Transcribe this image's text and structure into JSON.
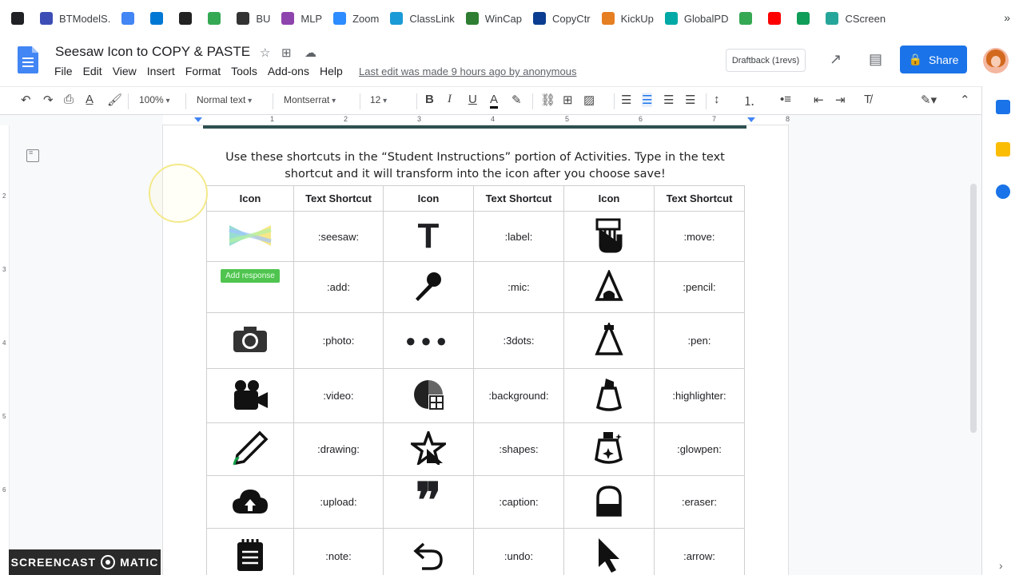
{
  "bookmarks": [
    {
      "label": "",
      "icon": "apps-icon",
      "color": "#202124"
    },
    {
      "label": "BTModelS.",
      "icon": "bookmark-icon",
      "color": "#3c4eb5"
    },
    {
      "label": "",
      "icon": "globe-icon",
      "color": "#4285f4"
    },
    {
      "label": "",
      "icon": "outlook-icon",
      "color": "#0078d4"
    },
    {
      "label": "",
      "icon": "s-circle-icon",
      "color": "#222"
    },
    {
      "label": "",
      "icon": "link-icon",
      "color": "#34a853"
    },
    {
      "label": "BU",
      "icon": "bu-icon",
      "color": "#333"
    },
    {
      "label": "MLP",
      "icon": "mlp-icon",
      "color": "#8e44ad"
    },
    {
      "label": "Zoom",
      "icon": "zoom-icon",
      "color": "#2d8cff"
    },
    {
      "label": "ClassLink",
      "icon": "classlink-icon",
      "color": "#1a9bd7"
    },
    {
      "label": "WinCap",
      "icon": "wincap-icon",
      "color": "#2e7d32"
    },
    {
      "label": "CopyCtr",
      "icon": "b-icon",
      "color": "#0a3d91"
    },
    {
      "label": "KickUp",
      "icon": "kickup-icon",
      "color": "#e67e22"
    },
    {
      "label": "GlobalPD",
      "icon": "globalpd-icon",
      "color": "#00a9a5"
    },
    {
      "label": "",
      "icon": "link-icon",
      "color": "#34a853"
    },
    {
      "label": "",
      "icon": "youtube-icon",
      "color": "#ff0000"
    },
    {
      "label": "",
      "icon": "sheet-icon",
      "color": "#0f9d58"
    },
    {
      "label": "CScreen",
      "icon": "cscreen-icon",
      "color": "#26a69a"
    }
  ],
  "bookmarks_more": "»",
  "doc": {
    "title": "Seesaw Icon to COPY & PASTE",
    "menu": [
      "File",
      "Edit",
      "View",
      "Insert",
      "Format",
      "Tools",
      "Add-ons",
      "Help"
    ],
    "last_edit": "Last edit was made 9 hours ago by anonymous",
    "draftback": "Draftback (1revs)",
    "share": "Share"
  },
  "toolbar": {
    "zoom": "100%",
    "style": "Normal text",
    "font": "Montserrat",
    "size": "12"
  },
  "ruler_numbers": [
    "1",
    "2",
    "3",
    "4",
    "5",
    "6",
    "7",
    "8"
  ],
  "vruler_numbers": [
    "2",
    "3",
    "4",
    "5",
    "6"
  ],
  "instructions": "Use these shortcuts in the “Student Instructions” portion of Activities.  Type in the text shortcut and it will transform into the icon after you choose save!",
  "table": {
    "headers": [
      "Icon",
      "Text Shortcut",
      "Icon",
      "Text Shortcut",
      "Icon",
      "Text Shortcut"
    ],
    "rows": [
      [
        ":seesaw:",
        ":label:",
        ":move:"
      ],
      [
        ":add:",
        ":mic:",
        ":pencil:"
      ],
      [
        ":photo:",
        ":3dots:",
        ":pen:"
      ],
      [
        ":video:",
        ":background:",
        ":highlighter:"
      ],
      [
        ":drawing:",
        ":shapes:",
        ":glowpen:"
      ],
      [
        ":upload:",
        ":caption:",
        ":eraser:"
      ],
      [
        ":note:",
        ":undo:",
        ":arrow:"
      ]
    ],
    "add_response": "Add response"
  },
  "watermark": {
    "left": "SCREENCAST",
    "right": "MATIC"
  }
}
